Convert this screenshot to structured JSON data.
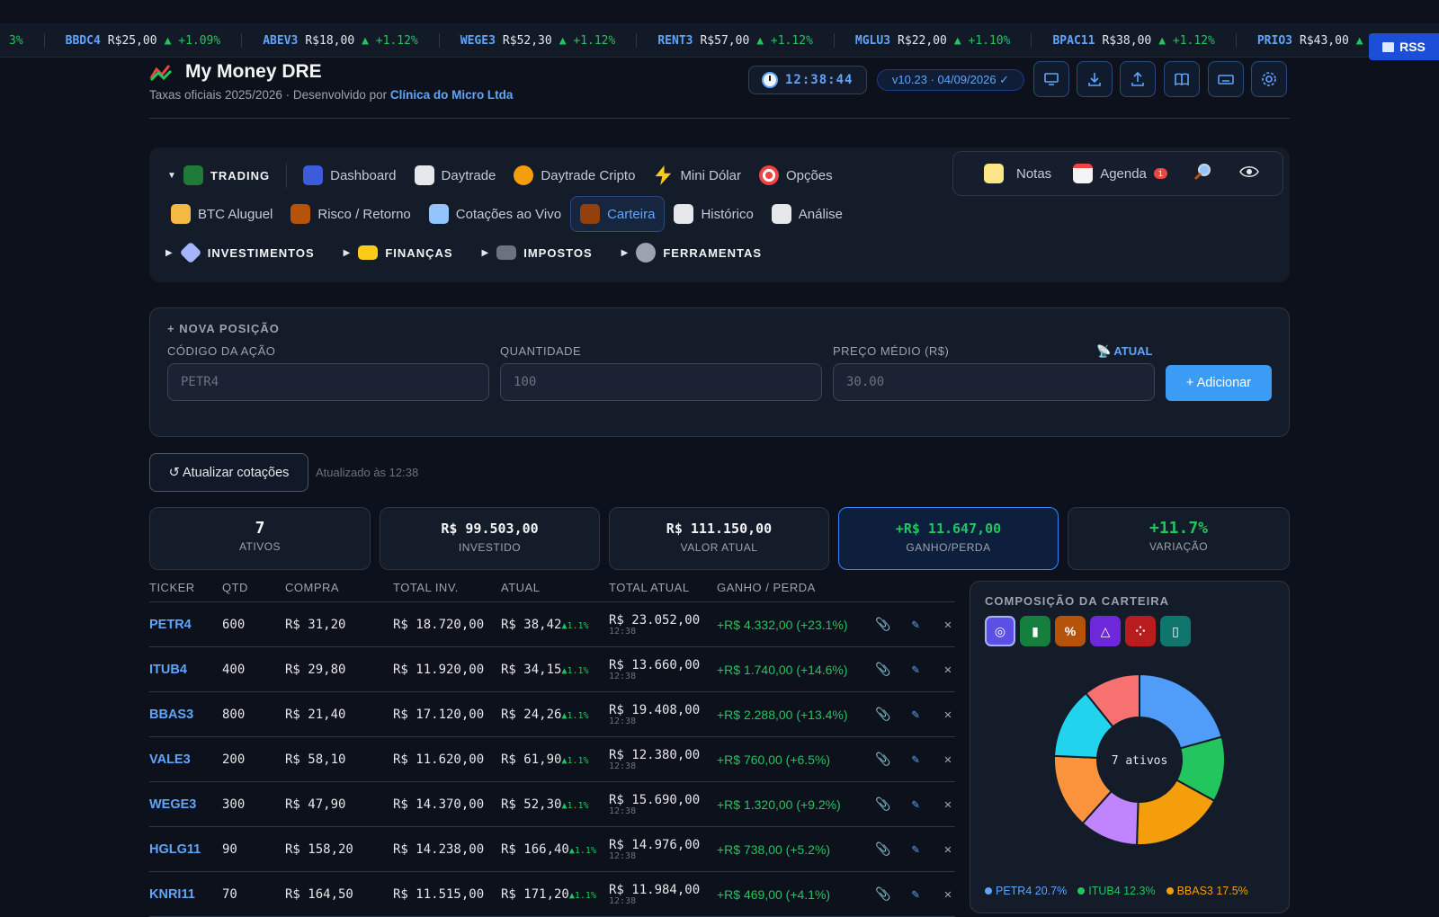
{
  "ticker": [
    {
      "sym": "",
      "price": "",
      "chg": "3%"
    },
    {
      "sym": "BBDC4",
      "price": "R$25,00",
      "chg": "▲ +1.09%"
    },
    {
      "sym": "ABEV3",
      "price": "R$18,00",
      "chg": "▲ +1.12%"
    },
    {
      "sym": "WEGE3",
      "price": "R$52,30",
      "chg": "▲ +1.12%"
    },
    {
      "sym": "RENT3",
      "price": "R$57,00",
      "chg": "▲ +1.12%"
    },
    {
      "sym": "MGLU3",
      "price": "R$22,00",
      "chg": "▲ +1.10%"
    },
    {
      "sym": "BPAC11",
      "price": "R$38,00",
      "chg": "▲ +1.12%"
    },
    {
      "sym": "PRIO3",
      "price": "R$43,00",
      "chg": "▲ +"
    }
  ],
  "rss_label": "RSS",
  "header": {
    "title": "My Money DRE",
    "subtitle": "Taxas oficiais 2025/2026 · Desenvolvido por",
    "developer": "Clínica do Micro Ltda",
    "clock": "12:38:44",
    "version": "v10.23 · 04/09/2026 ✓"
  },
  "nav": {
    "trading_label": "TRADING",
    "row1": [
      "Dashboard",
      "Daytrade",
      "Daytrade Cripto",
      "Mini Dólar",
      "Opções"
    ],
    "row2": [
      "BTC Aluguel",
      "Risco / Retorno",
      "Cotações ao Vivo",
      "Carteira",
      "Histórico",
      "Análise"
    ],
    "groups": [
      "INVESTIMENTOS",
      "FINANÇAS",
      "IMPOSTOS",
      "FERRAMENTAS"
    ],
    "tools": {
      "notes": "Notas",
      "agenda": "Agenda",
      "agenda_badge": "1"
    }
  },
  "form": {
    "title": "+ NOVA POSIÇÃO",
    "code_label": "CÓDIGO DA AÇÃO",
    "code_placeholder": "PETR4",
    "qty_label": "QUANTIDADE",
    "qty_placeholder": "100",
    "price_label": "PREÇO MÉDIO (R$)",
    "price_placeholder": "30.00",
    "atual_label": "ATUAL",
    "add_label": "+ Adicionar"
  },
  "refresh_label": "↺ Atualizar cotações",
  "updated_text": "Atualizado às 12:38",
  "stats": [
    {
      "value": "7",
      "label": "ATIVOS"
    },
    {
      "value": "R$ 99.503,00",
      "label": "INVESTIDO"
    },
    {
      "value": "R$ 111.150,00",
      "label": "VALOR ATUAL"
    },
    {
      "value": "+R$ 11.647,00",
      "label": "GANHO/PERDA"
    },
    {
      "value": "+11.7%",
      "label": "VARIAÇÃO"
    }
  ],
  "table": {
    "headers": [
      "TICKER",
      "QTD",
      "COMPRA",
      "TOTAL INV.",
      "ATUAL",
      "TOTAL ATUAL",
      "GANHO / PERDA"
    ],
    "rows": [
      {
        "ticker": "PETR4",
        "qtd": "600",
        "compra": "R$ 31,20",
        "total_inv": "R$ 18.720,00",
        "atual": "R$ 38,42",
        "chg": "▲1.1%",
        "total_atual": "R$ 23.052,00",
        "time": "12:38",
        "gain": "+R$ 4.332,00 (+23.1%)"
      },
      {
        "ticker": "ITUB4",
        "qtd": "400",
        "compra": "R$ 29,80",
        "total_inv": "R$ 11.920,00",
        "atual": "R$ 34,15",
        "chg": "▲1.1%",
        "total_atual": "R$ 13.660,00",
        "time": "12:38",
        "gain": "+R$ 1.740,00 (+14.6%)"
      },
      {
        "ticker": "BBAS3",
        "qtd": "800",
        "compra": "R$ 21,40",
        "total_inv": "R$ 17.120,00",
        "atual": "R$ 24,26",
        "chg": "▲1.1%",
        "total_atual": "R$ 19.408,00",
        "time": "12:38",
        "gain": "+R$ 2.288,00 (+13.4%)"
      },
      {
        "ticker": "VALE3",
        "qtd": "200",
        "compra": "R$ 58,10",
        "total_inv": "R$ 11.620,00",
        "atual": "R$ 61,90",
        "chg": "▲1.1%",
        "total_atual": "R$ 12.380,00",
        "time": "12:38",
        "gain": "+R$ 760,00 (+6.5%)"
      },
      {
        "ticker": "WEGE3",
        "qtd": "300",
        "compra": "R$ 47,90",
        "total_inv": "R$ 14.370,00",
        "atual": "R$ 52,30",
        "chg": "▲1.1%",
        "total_atual": "R$ 15.690,00",
        "time": "12:38",
        "gain": "+R$ 1.320,00 (+9.2%)"
      },
      {
        "ticker": "HGLG11",
        "qtd": "90",
        "compra": "R$ 158,20",
        "total_inv": "R$ 14.238,00",
        "atual": "R$ 166,40",
        "chg": "▲1.1%",
        "total_atual": "R$ 14.976,00",
        "time": "12:38",
        "gain": "+R$ 738,00 (+5.2%)"
      },
      {
        "ticker": "KNRI11",
        "qtd": "70",
        "compra": "R$ 164,50",
        "total_inv": "R$ 11.515,00",
        "atual": "R$ 171,20",
        "chg": "▲1.1%",
        "total_atual": "R$ 11.984,00",
        "time": "12:38",
        "gain": "+R$ 469,00 (+4.1%)"
      }
    ]
  },
  "composition": {
    "title": "COMPOSIÇÃO DA CARTEIRA",
    "center_label": "7 ativos",
    "legend": [
      {
        "name": "PETR4 20.7%",
        "color": "#60a5fa"
      },
      {
        "name": "ITUB4 12.3%",
        "color": "#22c55e"
      },
      {
        "name": "BBAS3 17.5%",
        "color": "#f59e0b"
      }
    ]
  },
  "chart_data": {
    "type": "pie",
    "categories": [
      "PETR4",
      "ITUB4",
      "BBAS3",
      "VALE3",
      "WEGE3",
      "HGLG11",
      "KNRI11"
    ],
    "values": [
      20.7,
      12.3,
      17.5,
      11.1,
      14.1,
      13.5,
      10.8
    ],
    "colors": [
      "#4f9cf9",
      "#22c55e",
      "#f59e0b",
      "#c084fc",
      "#fb923c",
      "#22d3ee",
      "#f87171"
    ],
    "title": "COMPOSIÇÃO DA CARTEIRA",
    "legend_position": "bottom"
  }
}
